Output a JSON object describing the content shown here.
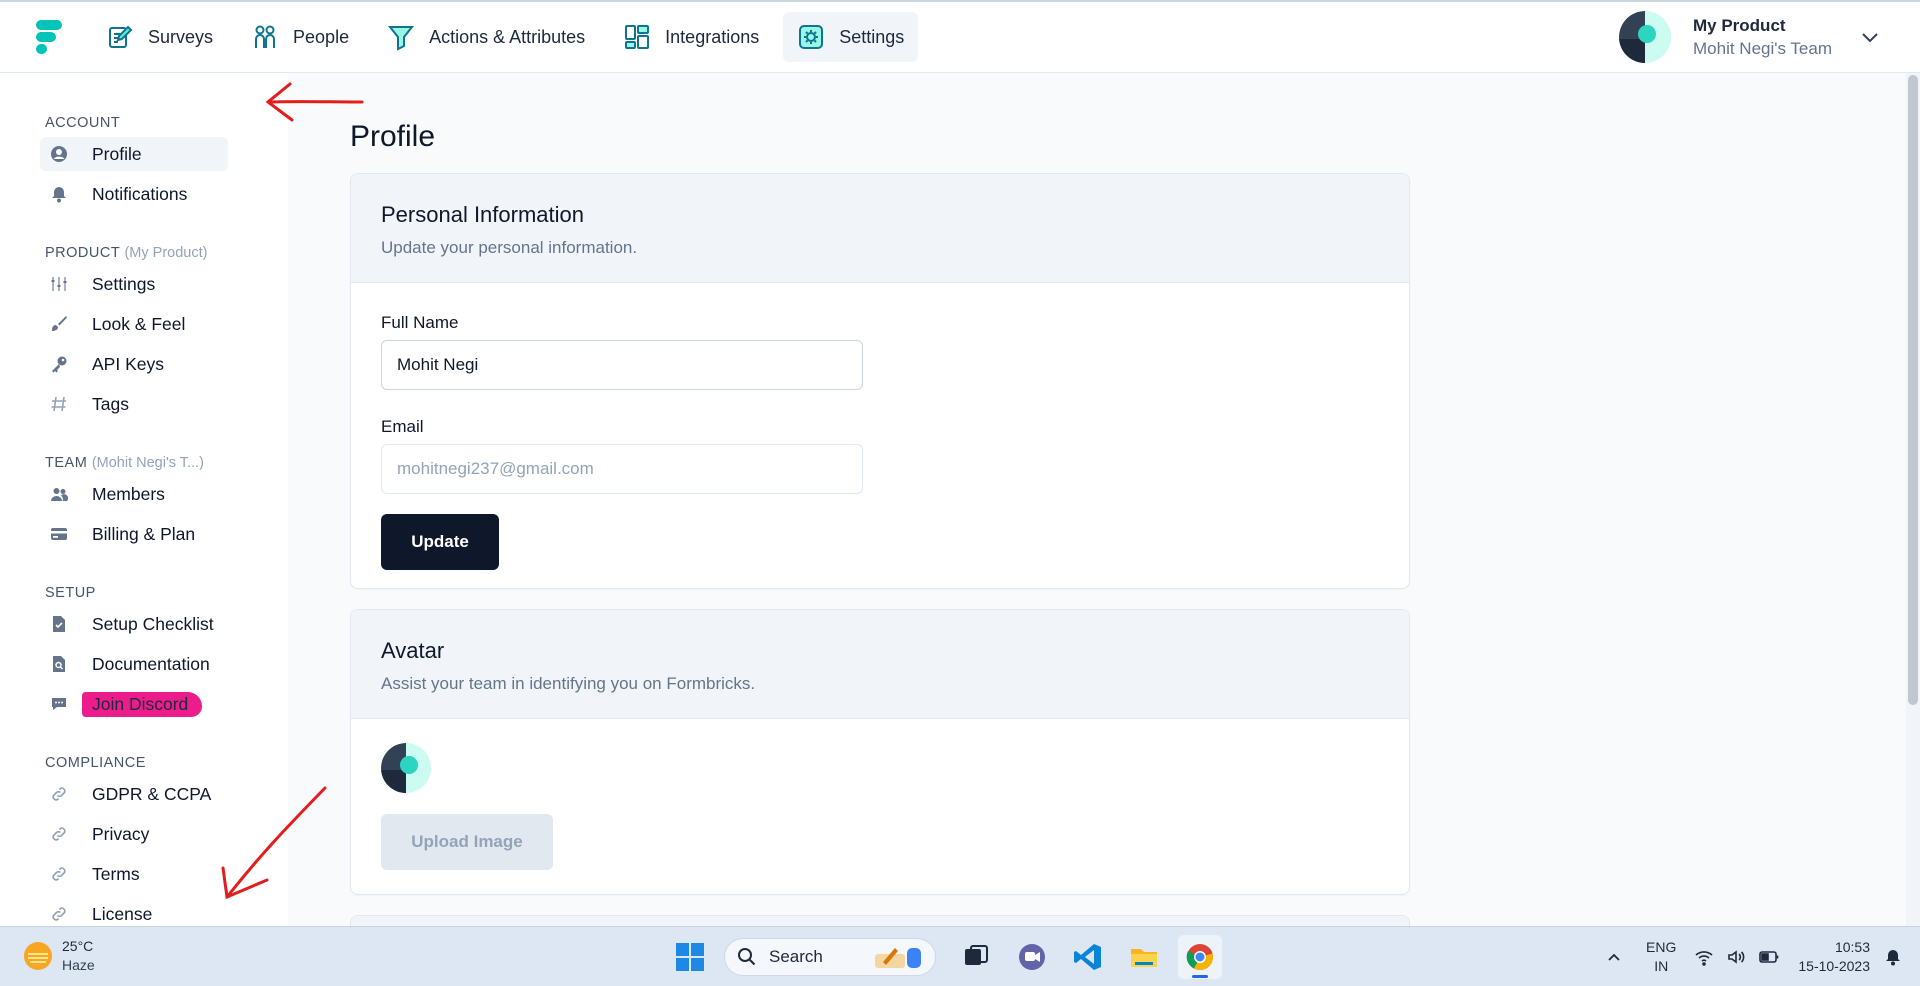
{
  "nav": {
    "items": [
      {
        "label": "Surveys",
        "icon": "survey-icon"
      },
      {
        "label": "People",
        "icon": "people-icon"
      },
      {
        "label": "Actions & Attributes",
        "icon": "filter-icon"
      },
      {
        "label": "Integrations",
        "icon": "integrations-icon"
      },
      {
        "label": "Settings",
        "icon": "settings-icon",
        "active": true
      }
    ],
    "product_title": "My Product",
    "team_name": "Mohit Negi's Team"
  },
  "sidebar": {
    "account": {
      "title": "ACCOUNT",
      "items": [
        {
          "label": "Profile",
          "icon": "user-circle-icon",
          "active": true
        },
        {
          "label": "Notifications",
          "icon": "bell-icon"
        }
      ]
    },
    "product": {
      "title": "PRODUCT",
      "subtitle": "(My Product)",
      "items": [
        {
          "label": "Settings",
          "icon": "sliders-icon"
        },
        {
          "label": "Look & Feel",
          "icon": "brush-icon"
        },
        {
          "label": "API Keys",
          "icon": "key-icon"
        },
        {
          "label": "Tags",
          "icon": "hash-icon"
        }
      ]
    },
    "team": {
      "title": "TEAM",
      "subtitle": "(Mohit Negi's T...)",
      "items": [
        {
          "label": "Members",
          "icon": "users-icon"
        },
        {
          "label": "Billing & Plan",
          "icon": "credit-card-icon"
        }
      ]
    },
    "setup": {
      "title": "SETUP",
      "items": [
        {
          "label": "Setup Checklist",
          "icon": "document-check-icon"
        },
        {
          "label": "Documentation",
          "icon": "document-search-icon"
        },
        {
          "label": "Join Discord",
          "icon": "chat-icon",
          "highlighted": true
        }
      ]
    },
    "compliance": {
      "title": "COMPLIANCE",
      "items": [
        {
          "label": "GDPR & CCPA",
          "icon": "link-icon"
        },
        {
          "label": "Privacy",
          "icon": "link-icon"
        },
        {
          "label": "Terms",
          "icon": "link-icon"
        },
        {
          "label": "License",
          "icon": "link-icon"
        }
      ]
    }
  },
  "main": {
    "title": "Profile",
    "personal": {
      "title": "Personal Information",
      "description": "Update your personal information.",
      "full_name_label": "Full Name",
      "full_name_value": "Mohit Negi",
      "email_label": "Email",
      "email_value": "mohitnegi237@gmail.com",
      "update_label": "Update"
    },
    "avatar": {
      "title": "Avatar",
      "description": "Assist your team in identifying you on Formbricks.",
      "upload_label": "Upload Image"
    }
  },
  "taskbar": {
    "temperature": "25°C",
    "weather": "Haze",
    "search_label": "Search",
    "lang_primary": "ENG",
    "lang_secondary": "IN",
    "time": "10:53",
    "date": "15-10-2023"
  },
  "colors": {
    "brand": "#00c4b8",
    "primary_button": "#0f172a",
    "highlight": "#ec1c8c",
    "annotation": "#e11d1d"
  }
}
